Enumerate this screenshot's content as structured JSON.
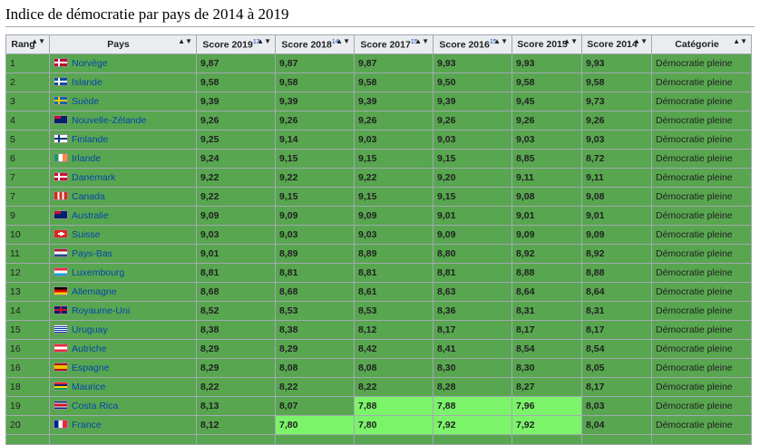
{
  "page_title": "Indice de démocratie par pays de 2014 à 2019",
  "columns": [
    {
      "label": "Rang",
      "ref": ""
    },
    {
      "label": "Pays",
      "ref": ""
    },
    {
      "label": "Score 2019",
      "ref": "13"
    },
    {
      "label": "Score 2018",
      "ref": "14"
    },
    {
      "label": "Score 2017",
      "ref": "15"
    },
    {
      "label": "Score 2016",
      "ref": "15"
    },
    {
      "label": "Score 2015",
      "ref": ""
    },
    {
      "label": "Score 2014",
      "ref": ""
    },
    {
      "label": "Catégorie",
      "ref": ""
    }
  ],
  "sort_icon_glyph": "▲▼",
  "colors": {
    "full_democracy": "#58a64f",
    "flawed_democracy": "#7cf46a",
    "header_bg": "#eaecf0",
    "link": "#0645ad",
    "border": "#a2a9b1"
  },
  "rows": [
    {
      "rank": "1",
      "country": "Norvège",
      "flag": "norway-flag-icon",
      "s2019": "9,87",
      "s2018": "9,87",
      "s2017": "9,87",
      "s2016": "9,93",
      "s2015": "9,93",
      "s2014": "9,93",
      "category": "Démocratie pleine"
    },
    {
      "rank": "2",
      "country": "Islande",
      "flag": "iceland-flag-icon",
      "s2019": "9,58",
      "s2018": "9,58",
      "s2017": "9,58",
      "s2016": "9,50",
      "s2015": "9,58",
      "s2014": "9,58",
      "category": "Démocratie pleine"
    },
    {
      "rank": "3",
      "country": "Suède",
      "flag": "sweden-flag-icon",
      "s2019": "9,39",
      "s2018": "9,39",
      "s2017": "9,39",
      "s2016": "9,39",
      "s2015": "9,45",
      "s2014": "9,73",
      "category": "Démocratie pleine"
    },
    {
      "rank": "4",
      "country": "Nouvelle-Zélande",
      "flag": "new-zealand-flag-icon",
      "s2019": "9,26",
      "s2018": "9,26",
      "s2017": "9,26",
      "s2016": "9,26",
      "s2015": "9,26",
      "s2014": "9,26",
      "category": "Démocratie pleine"
    },
    {
      "rank": "5",
      "country": "Finlande",
      "flag": "finland-flag-icon",
      "s2019": "9,25",
      "s2018": "9,14",
      "s2017": "9,03",
      "s2016": "9,03",
      "s2015": "9,03",
      "s2014": "9,03",
      "category": "Démocratie pleine"
    },
    {
      "rank": "6",
      "country": "Irlande",
      "flag": "ireland-flag-icon",
      "s2019": "9,24",
      "s2018": "9,15",
      "s2017": "9,15",
      "s2016": "9,15",
      "s2015": "8,85",
      "s2014": "8,72",
      "category": "Démocratie pleine"
    },
    {
      "rank": "7",
      "country": "Danemark",
      "flag": "denmark-flag-icon",
      "s2019": "9,22",
      "s2018": "9,22",
      "s2017": "9,22",
      "s2016": "9,20",
      "s2015": "9,11",
      "s2014": "9,11",
      "category": "Démocratie pleine"
    },
    {
      "rank": "7",
      "country": "Canada",
      "flag": "canada-flag-icon",
      "s2019": "9,22",
      "s2018": "9,15",
      "s2017": "9,15",
      "s2016": "9,15",
      "s2015": "9,08",
      "s2014": "9,08",
      "category": "Démocratie pleine"
    },
    {
      "rank": "9",
      "country": "Australie",
      "flag": "australia-flag-icon",
      "s2019": "9,09",
      "s2018": "9,09",
      "s2017": "9,09",
      "s2016": "9,01",
      "s2015": "9,01",
      "s2014": "9,01",
      "category": "Démocratie pleine"
    },
    {
      "rank": "10",
      "country": "Suisse",
      "flag": "switzerland-flag-icon",
      "s2019": "9,03",
      "s2018": "9,03",
      "s2017": "9,03",
      "s2016": "9,09",
      "s2015": "9,09",
      "s2014": "9,09",
      "category": "Démocratie pleine"
    },
    {
      "rank": "11",
      "country": "Pays-Bas",
      "flag": "netherlands-flag-icon",
      "s2019": "9,01",
      "s2018": "8,89",
      "s2017": "8,89",
      "s2016": "8,80",
      "s2015": "8,92",
      "s2014": "8,92",
      "category": "Démocratie pleine"
    },
    {
      "rank": "12",
      "country": "Luxembourg",
      "flag": "luxembourg-flag-icon",
      "s2019": "8,81",
      "s2018": "8,81",
      "s2017": "8,81",
      "s2016": "8,81",
      "s2015": "8,88",
      "s2014": "8,88",
      "category": "Démocratie pleine"
    },
    {
      "rank": "13",
      "country": "Allemagne",
      "flag": "germany-flag-icon",
      "s2019": "8,68",
      "s2018": "8,68",
      "s2017": "8,61",
      "s2016": "8,63",
      "s2015": "8,64",
      "s2014": "8,64",
      "category": "Démocratie pleine"
    },
    {
      "rank": "14",
      "country": "Royaume-Uni",
      "flag": "united-kingdom-flag-icon",
      "s2019": "8,52",
      "s2018": "8,53",
      "s2017": "8,53",
      "s2016": "8,36",
      "s2015": "8,31",
      "s2014": "8,31",
      "category": "Démocratie pleine"
    },
    {
      "rank": "15",
      "country": "Uruguay",
      "flag": "uruguay-flag-icon",
      "s2019": "8,38",
      "s2018": "8,38",
      "s2017": "8,12",
      "s2016": "8,17",
      "s2015": "8,17",
      "s2014": "8,17",
      "category": "Démocratie pleine"
    },
    {
      "rank": "16",
      "country": "Autriche",
      "flag": "austria-flag-icon",
      "s2019": "8,29",
      "s2018": "8,29",
      "s2017": "8,42",
      "s2016": "8,41",
      "s2015": "8,54",
      "s2014": "8,54",
      "category": "Démocratie pleine"
    },
    {
      "rank": "16",
      "country": "Espagne",
      "flag": "spain-flag-icon",
      "s2019": "8,29",
      "s2018": "8,08",
      "s2017": "8,08",
      "s2016": "8,30",
      "s2015": "8,30",
      "s2014": "8,05",
      "category": "Démocratie pleine"
    },
    {
      "rank": "18",
      "country": "Maurice",
      "flag": "mauritius-flag-icon",
      "s2019": "8,22",
      "s2018": "8,22",
      "s2017": "8,22",
      "s2016": "8,28",
      "s2015": "8,27",
      "s2014": "8,17",
      "category": "Démocratie pleine"
    },
    {
      "rank": "19",
      "country": "Costa Rica",
      "flag": "costa-rica-flag-icon",
      "s2019": "8,13",
      "s2018": "8,07",
      "s2017": "7,88",
      "s2016": "7,88",
      "s2015": "7,96",
      "s2014": "8,03",
      "category": "Démocratie pleine"
    },
    {
      "rank": "20",
      "country": "France",
      "flag": "france-flag-icon",
      "s2019": "8,12",
      "s2018": "7,80",
      "s2017": "7,80",
      "s2016": "7,92",
      "s2015": "7,92",
      "s2014": "8,04",
      "category": "Démocratie pleine"
    }
  ]
}
